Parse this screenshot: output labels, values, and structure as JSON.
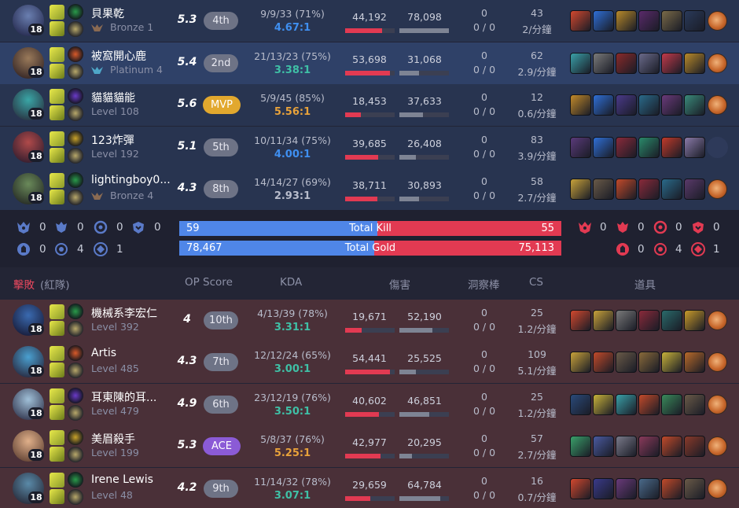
{
  "blue_team": {
    "players": [
      {
        "name": "貝果乾",
        "sub": "Bronze 1",
        "tier": "bronze",
        "level": "18",
        "op_score": "5.3",
        "rank": "4th",
        "badge": "",
        "kda": "9/9/33 (71%)",
        "ratio": "4.67:1",
        "ratio_color": "#3f8ff0",
        "dmg": "44,192",
        "dmg_pct": 0.74,
        "taken": "78,098",
        "taken_pct": 1.0,
        "wards": "0",
        "wards2": "0 / 0",
        "cs": "43",
        "csm": "2/分鐘",
        "champ_colors": [
          "#6a7fb0",
          "#2a2f55"
        ],
        "items": [
          "#d2482e",
          "#2f6fd6",
          "#b88a2a",
          "#5a2a6a",
          "#7a6a48",
          "#2a3a5a",
          "ward"
        ]
      },
      {
        "name": "被窩開心鹿",
        "sub": "Platinum 4",
        "tier": "platinum",
        "level": "18",
        "op_score": "5.4",
        "rank": "2nd",
        "badge": "",
        "kda": "21/13/23 (75%)",
        "ratio": "3.38:1",
        "ratio_color": "#3fc0a6",
        "dmg": "53,698",
        "dmg_pct": 0.9,
        "taken": "31,068",
        "taken_pct": 0.4,
        "wards": "0",
        "wards2": "0 / 0",
        "cs": "62",
        "csm": "2.9/分鐘",
        "champ_colors": [
          "#9a7a5a",
          "#3a2a28"
        ],
        "items": [
          "#3aa0a8",
          "#7a7a7a",
          "#8a2a2a",
          "#6a6a8a",
          "#c23a4a",
          "#b88a2a",
          "ward"
        ]
      },
      {
        "name": "貓貓貓能",
        "sub": "Level 108",
        "tier": "",
        "level": "18",
        "op_score": "5.6",
        "rank": "MVP",
        "badge": "mvp",
        "kda": "5/9/45 (85%)",
        "ratio": "5.56:1",
        "ratio_color": "#e8a23a",
        "dmg": "18,453",
        "dmg_pct": 0.31,
        "taken": "37,633",
        "taken_pct": 0.48,
        "wards": "0",
        "wards2": "0 / 0",
        "cs": "12",
        "csm": "0.6/分鐘",
        "champ_colors": [
          "#3aa6a6",
          "#2a3a48"
        ],
        "items": [
          "#c28a2a",
          "#2f6fd6",
          "#4a3a8a",
          "#2a6a8a",
          "#6a3a7a",
          "#3a8a7a",
          "ward"
        ]
      },
      {
        "name": "123炸彈",
        "sub": "Level 192",
        "tier": "",
        "level": "18",
        "op_score": "5.1",
        "rank": "5th",
        "badge": "",
        "kda": "10/11/34 (75%)",
        "ratio": "4.00:1",
        "ratio_color": "#3f8ff0",
        "dmg": "39,685",
        "dmg_pct": 0.66,
        "taken": "26,408",
        "taken_pct": 0.34,
        "wards": "0",
        "wards2": "0 / 0",
        "cs": "83",
        "csm": "3.9/分鐘",
        "champ_colors": [
          "#b04a4a",
          "#3a2030"
        ],
        "items": [
          "#5a3a7a",
          "#2f6fd6",
          "#8a2a3a",
          "#2a8a6a",
          "#c23a2a",
          "#8a7aa8",
          "empty"
        ]
      },
      {
        "name": "lightingboy0...",
        "sub": "Bronze 4",
        "tier": "bronze",
        "level": "18",
        "op_score": "4.3",
        "rank": "8th",
        "badge": "",
        "kda": "14/14/27 (69%)",
        "ratio": "2.93:1",
        "ratio_color": "#b8bccb",
        "dmg": "38,711",
        "dmg_pct": 0.65,
        "taken": "30,893",
        "taken_pct": 0.4,
        "wards": "0",
        "wards2": "0 / 0",
        "cs": "58",
        "csm": "2.7/分鐘",
        "champ_colors": [
          "#6a8a5a",
          "#2a3028"
        ],
        "items": [
          "#c8a23a",
          "#6a5a48",
          "#c24a2a",
          "#8a2a3a",
          "#2a6a8a",
          "#5a3a6a",
          "ward"
        ]
      }
    ]
  },
  "objectives": {
    "blue": {
      "baron": "0",
      "dragon": "0",
      "herald": "0",
      "grub": "0",
      "tower": "0",
      "inhib": "4",
      "plate": "1"
    },
    "red": {
      "baron": "0",
      "dragon": "0",
      "herald": "0",
      "grub": "0",
      "tower": "0",
      "inhib": "4",
      "plate": "1"
    }
  },
  "totals": {
    "kill_label": "Total Kill",
    "kill_blue": "59",
    "kill_red": "55",
    "kill_blue_share": 0.518,
    "gold_label": "Total Gold",
    "gold_blue": "78,467",
    "gold_red": "75,113",
    "gold_blue_share": 0.511
  },
  "header": {
    "team": "擊敗",
    "team_side": "(紅隊)",
    "op_score": "OP Score",
    "kda": "KDA",
    "damage": "傷害",
    "wards": "洞察棒",
    "cs": "CS",
    "items": "道具"
  },
  "red_team": {
    "players": [
      {
        "name": "機械系李宏仁",
        "sub": "Level 392",
        "tier": "",
        "level": "18",
        "op_score": "4",
        "rank": "10th",
        "badge": "",
        "kda": "4/13/39 (78%)",
        "ratio": "3.31:1",
        "ratio_color": "#3fc0a6",
        "dmg": "19,671",
        "dmg_pct": 0.33,
        "taken": "52,190",
        "taken_pct": 0.67,
        "wards": "0",
        "wards2": "0 / 0",
        "cs": "25",
        "csm": "1.2/分鐘",
        "champ_colors": [
          "#3a6ab0",
          "#1a2040"
        ],
        "items": [
          "#d2482e",
          "#c8a23a",
          "#7a7a7a",
          "#8a2a3a",
          "#2a6a6a",
          "#c89a2a",
          "ward"
        ]
      },
      {
        "name": "Artis",
        "sub": "Level 485",
        "tier": "",
        "level": "18",
        "op_score": "4.3",
        "rank": "7th",
        "badge": "",
        "kda": "12/12/24 (65%)",
        "ratio": "3.00:1",
        "ratio_color": "#3fc0a6",
        "dmg": "54,441",
        "dmg_pct": 0.91,
        "taken": "25,525",
        "taken_pct": 0.33,
        "wards": "0",
        "wards2": "0 / 0",
        "cs": "109",
        "csm": "5.1/分鐘",
        "champ_colors": [
          "#4aa0d0",
          "#2a3048"
        ],
        "items": [
          "#c8a23a",
          "#c24a2a",
          "#6a5a48",
          "#8a6a3a",
          "#c8b23a",
          "#b86a2a",
          "ward"
        ]
      },
      {
        "name": "耳東陳的耳...",
        "sub": "Level 479",
        "tier": "",
        "level": "18",
        "op_score": "4.9",
        "rank": "6th",
        "badge": "",
        "kda": "23/12/19 (76%)",
        "ratio": "3.50:1",
        "ratio_color": "#3fc0a6",
        "dmg": "40,602",
        "dmg_pct": 0.68,
        "taken": "46,851",
        "taken_pct": 0.6,
        "wards": "0",
        "wards2": "0 / 0",
        "cs": "25",
        "csm": "1.2/分鐘",
        "champ_colors": [
          "#a0c0d8",
          "#3a4058"
        ],
        "items": [
          "#2a4a7a",
          "#c8b23a",
          "#3aa0a8",
          "#c24a2a",
          "#3a8a5a",
          "#6a5a48",
          "ward"
        ]
      },
      {
        "name": "美眉殺手",
        "sub": "Level 199",
        "tier": "",
        "level": "18",
        "op_score": "5.3",
        "rank": "ACE",
        "badge": "ace",
        "kda": "5/8/37 (76%)",
        "ratio": "5.25:1",
        "ratio_color": "#e8a23a",
        "dmg": "42,977",
        "dmg_pct": 0.72,
        "taken": "20,295",
        "taken_pct": 0.26,
        "wards": "0",
        "wards2": "0 / 0",
        "cs": "57",
        "csm": "2.7/分鐘",
        "champ_colors": [
          "#e0b08a",
          "#6a4a3a"
        ],
        "items": [
          "#3aa06a",
          "#4a5aa0",
          "#7a7a8a",
          "#8a3a5a",
          "#c24a2a",
          "#8a3a2a",
          "ward"
        ]
      },
      {
        "name": "Irene Lewis",
        "sub": "Level 48",
        "tier": "",
        "level": "18",
        "op_score": "4.2",
        "rank": "9th",
        "badge": "",
        "kda": "11/14/32 (78%)",
        "ratio": "3.07:1",
        "ratio_color": "#3fc0a6",
        "dmg": "29,659",
        "dmg_pct": 0.5,
        "taken": "64,784",
        "taken_pct": 0.83,
        "wards": "0",
        "wards2": "0 / 0",
        "cs": "16",
        "csm": "0.7/分鐘",
        "champ_colors": [
          "#5a8aa8",
          "#2a3040"
        ],
        "items": [
          "#d2482e",
          "#3a3a8a",
          "#6a3a7a",
          "#4a6a8a",
          "#c24a2a",
          "#6a5a48",
          "ward"
        ]
      }
    ]
  }
}
